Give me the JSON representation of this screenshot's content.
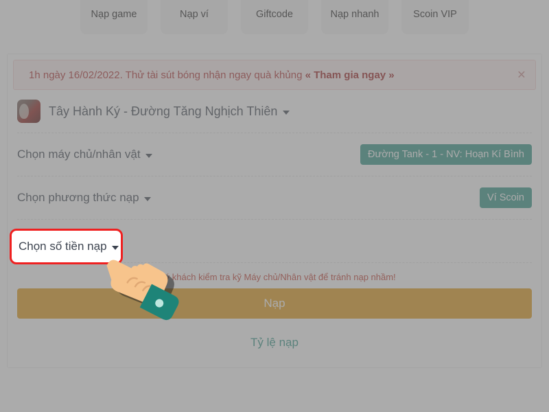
{
  "quicknav": {
    "items": [
      {
        "label": "Nạp game",
        "icon": "coin-stack-icon"
      },
      {
        "label": "Nạp ví",
        "icon": "wallet-icon"
      },
      {
        "label": "Giftcode",
        "icon": "gift-ticket-icon"
      },
      {
        "label": "Nạp nhanh",
        "icon": "fast-coin-icon"
      },
      {
        "label": "Scoin VIP",
        "icon": "scoin-vip-icon"
      }
    ]
  },
  "banner": {
    "text_before": "1h ngày 16/02/2022. Thử tài sút bóng nhận ngay quà khủng ",
    "link_text": "« Tham gia ngay »",
    "close_icon": "×"
  },
  "game": {
    "title": "Tây Hành Ký - Đường Tăng Nghịch Thiên",
    "avatar_name": "game-avatar"
  },
  "form": {
    "server_row": {
      "label": "Chọn máy chủ/nhân vật",
      "value": "Đường Tank - 1 - NV: Hoạn Kí Bình"
    },
    "method_row": {
      "label": "Chọn phương thức nạp",
      "value": "Ví Scoin"
    },
    "amount_row": {
      "label": "Chọn số tiền nạp"
    },
    "note": "Quý khách kiểm tra kỹ Máy chủ/Nhân vật để tránh nạp nhầm!",
    "submit_label": "Nạp",
    "rate_link": "Tỷ lệ nạp"
  },
  "colors": {
    "accent_green": "#2f9384",
    "submit_orange": "#e29a14",
    "highlight_red": "#ef2020",
    "banner_red": "#b03030"
  }
}
